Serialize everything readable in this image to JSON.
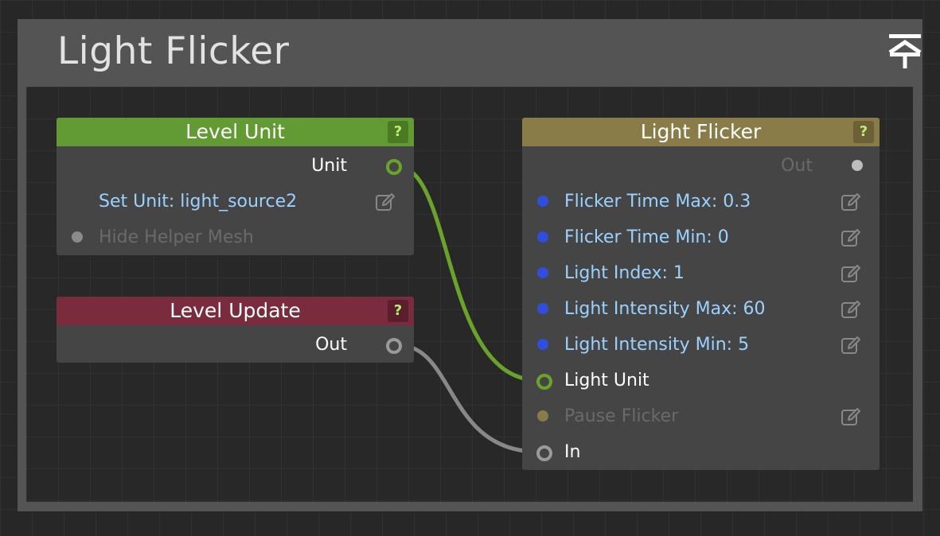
{
  "group": {
    "title": "Light Flicker"
  },
  "level_unit": {
    "title": "Level Unit",
    "help": "?",
    "output_label": "Unit",
    "set_unit": "Set Unit: light_source2",
    "hide_helper": "Hide Helper Mesh"
  },
  "level_update": {
    "title": "Level Update",
    "help": "?",
    "output_label": "Out"
  },
  "light_flicker": {
    "title": "Light Flicker",
    "help": "?",
    "out_label": "Out",
    "flicker_time_max": "Flicker Time Max: 0.3",
    "flicker_time_min": "Flicker Time Min: 0",
    "light_index": "Light Index: 1",
    "light_intensity_max": "Light Intensity Max: 60",
    "light_intensity_min": "Light Intensity Min: 5",
    "light_unit": "Light Unit",
    "pause_flicker": "Pause Flicker",
    "in": "In"
  },
  "colors": {
    "level_unit_header": "#629a33",
    "level_update_header": "#7a2b3e",
    "light_flicker_header": "#8a7c49",
    "param_port_blue": "#2f4ee0",
    "link_green": "#6aa32a",
    "link_gray": "#888888",
    "param_text": "#9ad2ff"
  }
}
